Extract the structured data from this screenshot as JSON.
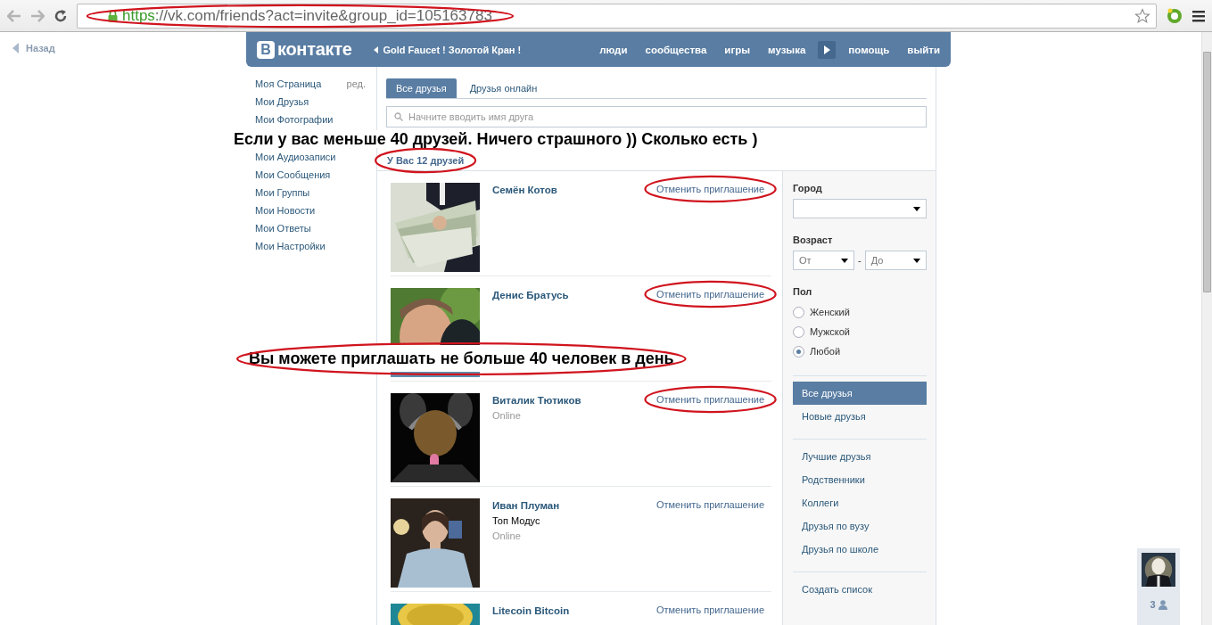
{
  "browser": {
    "url": "https://vk.com/friends?act=invite&group_id=105163783",
    "url_circled": true
  },
  "back_link": "Назад",
  "header": {
    "logo_letter": "В",
    "logo_text": "контакте",
    "group_link": "Gold Faucet ! Золотой Кран !",
    "nav": [
      {
        "kind": "link",
        "label": "люди"
      },
      {
        "kind": "link",
        "label": "сообщества"
      },
      {
        "kind": "link",
        "label": "игры"
      },
      {
        "kind": "link",
        "label": "музыка"
      },
      {
        "kind": "more"
      },
      {
        "kind": "link",
        "label": "помощь"
      },
      {
        "kind": "link",
        "label": "выйти"
      }
    ]
  },
  "left_menu": [
    {
      "label": "Моя Страница",
      "extra": "ред."
    },
    {
      "label": "Мои Друзья"
    },
    {
      "label": "Мои Фотографии"
    },
    {
      "label": "Мои Аудиозаписи",
      "gap_before": true
    },
    {
      "label": "Мои Сообщения"
    },
    {
      "label": "Мои Группы"
    },
    {
      "label": "Мои Новости"
    },
    {
      "label": "Мои Ответы"
    },
    {
      "label": "Мои Настройки"
    }
  ],
  "tabs": [
    {
      "label": "Все друзья",
      "selected": true
    },
    {
      "label": "Друзья онлайн",
      "selected": false
    }
  ],
  "search": {
    "placeholder": "Начните вводить имя друга"
  },
  "friend_count": {
    "text": "У Вас 12 друзей",
    "circled": true
  },
  "friends": [
    {
      "name": "Семён Котов",
      "action": "Отменить приглашение",
      "circled": true
    },
    {
      "name": "Денис Братусь",
      "action": "Отменить приглашение",
      "circled": true
    },
    {
      "name": "Виталик Тютиков",
      "status": "Online",
      "action": "Отменить приглашение",
      "circled": true
    },
    {
      "name": "Иван Плуман",
      "subtitle": "Топ Модус",
      "status": "Online",
      "action": "Отменить приглашение",
      "circled": false
    },
    {
      "name": "Litecoin Bitcoin",
      "action": "Отменить приглашение",
      "circled": false
    }
  ],
  "filters": {
    "city_label": "Город",
    "age_label": "Возраст",
    "age_from": "От",
    "age_dash": "-",
    "age_to": "До",
    "gender_label": "Пол",
    "gender_options": [
      {
        "label": "Женский",
        "selected": false
      },
      {
        "label": "Мужской",
        "selected": false
      },
      {
        "label": "Любой",
        "selected": true
      }
    ]
  },
  "friend_lists": [
    [
      {
        "label": "Все друзья",
        "selected": true
      },
      {
        "label": "Новые друзья",
        "selected": false
      }
    ],
    [
      {
        "label": "Лучшие друзья",
        "selected": false
      },
      {
        "label": "Родственники",
        "selected": false
      },
      {
        "label": "Коллеги",
        "selected": false
      },
      {
        "label": "Друзья по вузу",
        "selected": false
      },
      {
        "label": "Друзья по школе",
        "selected": false
      }
    ],
    [
      {
        "label": "Создать список",
        "selected": false
      }
    ]
  ],
  "annotations": [
    {
      "text": "Если у вас меньше 40 друзей. Ничего страшного )) Сколько есть )",
      "circled": false
    },
    {
      "text": "Вы можете приглашать не больше 40 человек в день",
      "circled": true
    }
  ],
  "chat": {
    "count": "3"
  }
}
